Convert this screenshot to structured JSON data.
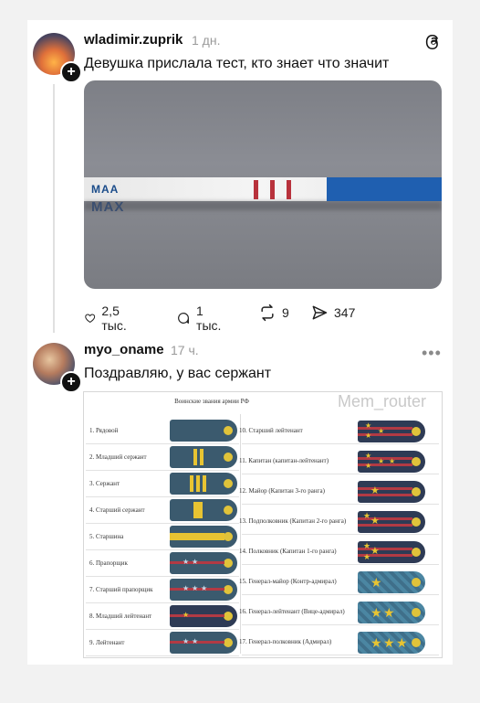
{
  "post": {
    "username": "wladimir.zuprik",
    "time": "1 дн.",
    "text": "Девушка прислала тест, кто знает что значит",
    "photo_label_top": "MAA",
    "photo_label_bottom": "MAX",
    "stats": {
      "likes": "2,5 тыс.",
      "replies": "1 тыс.",
      "reposts": "9",
      "shares": "347"
    }
  },
  "reply": {
    "username": "myo_oname",
    "time": "17 ч.",
    "text": "Поздравляю, у вас сержант",
    "table": {
      "title": "Воинские звания армии РФ",
      "watermark": "Mem_router",
      "left_ranks": [
        "1. Рядовой",
        "2. Младший сержант",
        "3. Сержант",
        "4. Старший сержант",
        "5. Старшина",
        "6. Прапорщик",
        "7. Старший прапорщик",
        "8. Младший лейтенант",
        "9. Лейтенант"
      ],
      "right_ranks": [
        "10. Старший лейтенант",
        "11. Капитан (капитан-лейтенант)",
        "12. Майор (Капитан 3-го ранга)",
        "13. Подполковник (Капитан 2-го ранга)",
        "14. Полковник (Капитан 1-го ранга)",
        "15. Генерал-майор (Контр-адмирал)",
        "16. Генерал-лейтенант (Вице-адмирал)",
        "17. Генерал-полковник (Адмирал)"
      ]
    }
  },
  "icons": {
    "like": "heart-icon",
    "reply": "comment-icon",
    "repost": "repost-icon",
    "share": "send-icon",
    "app": "threads-logo-icon",
    "more": "more-icon"
  },
  "colors": {
    "strap_army": "#3b5a6e",
    "strap_officer": "#2e3b55",
    "strap_general": "#3f6f8a",
    "stripe_gold": "#e8c432",
    "stripe_red": "#b23a44",
    "strip_blue": "#1f5fb0"
  }
}
